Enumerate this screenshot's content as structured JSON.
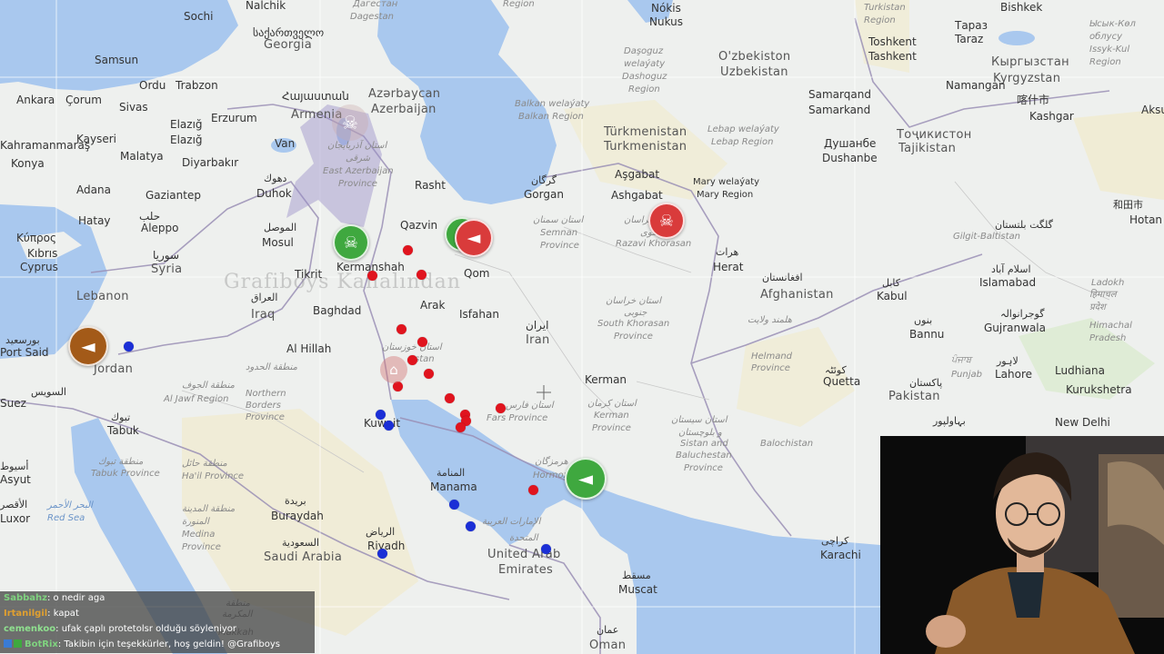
{
  "map": {
    "colors": {
      "water": "#a9c8ee",
      "land": "#eef0ee",
      "desert": "#f2e9c4",
      "green": "#d6e9c6",
      "border": "#9a8fb5",
      "protest_green": "#3fa83f",
      "protest_red": "#d93b3b",
      "protest_brown": "#a35a18",
      "dot_red": "#e0141e",
      "dot_blue": "#1b2fd6"
    },
    "watermark": "Grafiboys Kanalından",
    "cities": [
      {
        "id": "nalchik",
        "text": "Nalchik"
      },
      {
        "id": "sochi",
        "text": "Sochi"
      },
      {
        "id": "georgia-geo",
        "text": "საქართველო"
      },
      {
        "id": "georgia",
        "text": "Georgia"
      },
      {
        "id": "samsun",
        "text": "Samsun"
      },
      {
        "id": "ordu",
        "text": "Ordu"
      },
      {
        "id": "trabzon",
        "text": "Trabzon"
      },
      {
        "id": "ankara",
        "text": "Ankara"
      },
      {
        "id": "corum",
        "text": "Çorum"
      },
      {
        "id": "sivas",
        "text": "Sivas"
      },
      {
        "id": "elazig1",
        "text": "Elazığ"
      },
      {
        "id": "elazig2",
        "text": "Elazığ"
      },
      {
        "id": "erzurum",
        "text": "Erzurum"
      },
      {
        "id": "kayseri",
        "text": "Kayseri"
      },
      {
        "id": "kahramanmaras",
        "text": "Kahramanmaraş"
      },
      {
        "id": "konya",
        "text": "Konya"
      },
      {
        "id": "malatya",
        "text": "Malatya"
      },
      {
        "id": "diyarbakir",
        "text": "Diyarbakır"
      },
      {
        "id": "adana",
        "text": "Adana"
      },
      {
        "id": "gaziantep",
        "text": "Gaziantep"
      },
      {
        "id": "hatay",
        "text": "Hatay"
      },
      {
        "id": "aleppo-ar",
        "text": "حلب"
      },
      {
        "id": "aleppo",
        "text": "Aleppo"
      },
      {
        "id": "kibris",
        "text": "Κύπρος"
      },
      {
        "id": "kibris2",
        "text": "Kıbrıs"
      },
      {
        "id": "cyprus",
        "text": "Cyprus"
      },
      {
        "id": "syria-ar",
        "text": "سوريا"
      },
      {
        "id": "syria",
        "text": "Syria"
      },
      {
        "id": "lebanon",
        "text": "Lebanon"
      },
      {
        "id": "portsaid-ar",
        "text": "بورسعيد"
      },
      {
        "id": "portsaid",
        "text": "Port Said"
      },
      {
        "id": "jordan",
        "text": "Jordan"
      },
      {
        "id": "suez-ar",
        "text": "السويس"
      },
      {
        "id": "suez",
        "text": "Suez"
      },
      {
        "id": "tabuk-ar",
        "text": "تبوك"
      },
      {
        "id": "tabuk",
        "text": "Tabuk"
      },
      {
        "id": "asyut-ar",
        "text": "أسيوط"
      },
      {
        "id": "asyut",
        "text": "Asyut"
      },
      {
        "id": "luxor-ar",
        "text": "الأقصر"
      },
      {
        "id": "luxor",
        "text": "Luxor"
      },
      {
        "id": "armenia-ar",
        "text": "Հայաստան"
      },
      {
        "id": "armenia",
        "text": "Armenia"
      },
      {
        "id": "azerbaycan",
        "text": "Azərbaycan"
      },
      {
        "id": "azerbaijan",
        "text": "Azerbaijan"
      },
      {
        "id": "van",
        "text": "Van"
      },
      {
        "id": "duhok-ar",
        "text": "دهوك"
      },
      {
        "id": "duhok",
        "text": "Duhok"
      },
      {
        "id": "mosul-ar",
        "text": "الموصل"
      },
      {
        "id": "mosul",
        "text": "Mosul"
      },
      {
        "id": "tikrit",
        "text": "Tikrit"
      },
      {
        "id": "iraq-ar",
        "text": "العراق"
      },
      {
        "id": "iraq",
        "text": "Iraq"
      },
      {
        "id": "baghdad",
        "text": "Baghdad"
      },
      {
        "id": "alhillah",
        "text": "Al Hillah"
      },
      {
        "id": "kermanshah",
        "text": "Kermanshah"
      },
      {
        "id": "qazvin",
        "text": "Qazvin"
      },
      {
        "id": "rasht",
        "text": "Rasht"
      },
      {
        "id": "qom",
        "text": "Qom"
      },
      {
        "id": "arak",
        "text": "Arak"
      },
      {
        "id": "isfahan",
        "text": "Isfahan"
      },
      {
        "id": "iran-ar",
        "text": "ایران"
      },
      {
        "id": "iran",
        "text": "Iran"
      },
      {
        "id": "gorgan-ar",
        "text": "گرگان"
      },
      {
        "id": "gorgan",
        "text": "Gorgan"
      },
      {
        "id": "kerman",
        "text": "Kerman"
      },
      {
        "id": "kuwait",
        "text": "Kuwait"
      },
      {
        "id": "manama-ar",
        "text": "المنامة"
      },
      {
        "id": "manama",
        "text": "Manama"
      },
      {
        "id": "buraydah-ar",
        "text": "بريدة"
      },
      {
        "id": "buraydah",
        "text": "Buraydah"
      },
      {
        "id": "riyadh-ar",
        "text": "الرياض"
      },
      {
        "id": "riyadh",
        "text": "Riyadh"
      },
      {
        "id": "saudi-ar",
        "text": "السعودية"
      },
      {
        "id": "saudi",
        "text": "Saudi Arabia"
      },
      {
        "id": "uae",
        "text": "United Arab"
      },
      {
        "id": "emirates",
        "text": "Emirates"
      },
      {
        "id": "muscat-ar",
        "text": "مسقط"
      },
      {
        "id": "muscat",
        "text": "Muscat"
      },
      {
        "id": "oman-ar",
        "text": "عمان"
      },
      {
        "id": "oman",
        "text": "Oman"
      },
      {
        "id": "ashgabat1",
        "text": "Aşgabat"
      },
      {
        "id": "ashgabat2",
        "text": "Ashgabat"
      },
      {
        "id": "turkmenistan1",
        "text": "Türkmenistan"
      },
      {
        "id": "turkmenistan2",
        "text": "Turkmenistan"
      },
      {
        "id": "nukus1",
        "text": "Nókis"
      },
      {
        "id": "nukus2",
        "text": "Nukus"
      },
      {
        "id": "uzbekistan1",
        "text": "O'zbekiston"
      },
      {
        "id": "uzbekistan2",
        "text": "Uzbekistan"
      },
      {
        "id": "samarkand1",
        "text": "Samarqand"
      },
      {
        "id": "samarkand2",
        "text": "Samarkand"
      },
      {
        "id": "dushanbe1",
        "text": "Душанбе"
      },
      {
        "id": "dushanbe2",
        "text": "Dushanbe"
      },
      {
        "id": "tajikistan1",
        "text": "Тоҷикистон"
      },
      {
        "id": "tajikistan2",
        "text": "Tajikistan"
      },
      {
        "id": "tashkent1",
        "text": "Toshkent"
      },
      {
        "id": "tashkent2",
        "text": "Tashkent"
      },
      {
        "id": "namangan",
        "text": "Namangan"
      },
      {
        "id": "kyrgyzstan1",
        "text": "Кыргызстан"
      },
      {
        "id": "kyrgyzstan2",
        "text": "Kyrgyzstan"
      },
      {
        "id": "bishkek",
        "text": "Bishkek"
      },
      {
        "id": "taraz1",
        "text": "Тараз"
      },
      {
        "id": "taraz2",
        "text": "Taraz"
      },
      {
        "id": "kashgar1",
        "text": "喀什市"
      },
      {
        "id": "kashgar2",
        "text": "Kashgar"
      },
      {
        "id": "hotan1",
        "text": "和田市"
      },
      {
        "id": "hotan2",
        "text": "Hotan"
      },
      {
        "id": "herat-ar",
        "text": "هرات"
      },
      {
        "id": "herat",
        "text": "Herat"
      },
      {
        "id": "afghanistan-ar",
        "text": "افغانستان"
      },
      {
        "id": "afghanistan",
        "text": "Afghanistan"
      },
      {
        "id": "kabul-ar",
        "text": "کابل"
      },
      {
        "id": "kabul",
        "text": "Kabul"
      },
      {
        "id": "islamabad-ar",
        "text": "اسلام آباد"
      },
      {
        "id": "islamabad",
        "text": "Islamabad"
      },
      {
        "id": "gujranwala-ar",
        "text": "گوجرانوالہ"
      },
      {
        "id": "gujranwala",
        "text": "Gujranwala"
      },
      {
        "id": "bannu-ar",
        "text": "بنوں"
      },
      {
        "id": "bannu",
        "text": "Bannu"
      },
      {
        "id": "lahore-ar",
        "text": "لاہور"
      },
      {
        "id": "lahore",
        "text": "Lahore"
      },
      {
        "id": "ludhiana",
        "text": "Ludhiana"
      },
      {
        "id": "kurukshetra",
        "text": "Kurukshetra"
      },
      {
        "id": "quetta-ar",
        "text": "کوئٹہ"
      },
      {
        "id": "quetta",
        "text": "Quetta"
      },
      {
        "id": "pakistan-ar",
        "text": "پاکستان"
      },
      {
        "id": "pakistan",
        "text": "Pakistan"
      },
      {
        "id": "newdelhi",
        "text": "New Delhi"
      },
      {
        "id": "bahawalpur-ar",
        "text": "بہاولپور"
      },
      {
        "id": "karachi-ar",
        "text": "کراچی"
      },
      {
        "id": "karachi",
        "text": "Karachi"
      },
      {
        "id": "aksu",
        "text": "Aksu"
      },
      {
        "id": "gilgit-ar",
        "text": "گلگت بلتستان"
      },
      {
        "id": "mary",
        "text": "Mary welaýaty"
      },
      {
        "id": "mary2",
        "text": "Mary Region"
      }
    ],
    "provinces": [
      {
        "id": "dagestan",
        "text": "Dagestan"
      },
      {
        "id": "dagestan2",
        "text": "Дагестан"
      },
      {
        "id": "region-top",
        "text": "Region"
      },
      {
        "id": "daoguz1",
        "text": "Daşoguz"
      },
      {
        "id": "daoguz2",
        "text": "welaýaty"
      },
      {
        "id": "daoguz3",
        "text": "Dashoguz"
      },
      {
        "id": "daoguz4",
        "text": "Region"
      },
      {
        "id": "balkan1",
        "text": "Balkan welaýaty"
      },
      {
        "id": "balkan2",
        "text": "Balkan Region"
      },
      {
        "id": "lebap1",
        "text": "Lebap welaýaty"
      },
      {
        "id": "lebap2",
        "text": "Lebap Region"
      },
      {
        "id": "turkistan1",
        "text": "Turkistan"
      },
      {
        "id": "turkistan2",
        "text": "Region"
      },
      {
        "id": "issyk1",
        "text": "Ысык-Көл"
      },
      {
        "id": "issyk2",
        "text": "облусу"
      },
      {
        "id": "issyk3",
        "text": "Issyk-Kul"
      },
      {
        "id": "issyk4",
        "text": "Region"
      },
      {
        "id": "eastazer1",
        "text": "استان آذربایجان"
      },
      {
        "id": "eastazer2",
        "text": "شرقی"
      },
      {
        "id": "eastazer3",
        "text": "East Azerbaijan"
      },
      {
        "id": "eastazer4",
        "text": "Province"
      },
      {
        "id": "semnan1",
        "text": "استان سمنان"
      },
      {
        "id": "semnan2",
        "text": "Semnan"
      },
      {
        "id": "semnan3",
        "text": "Province"
      },
      {
        "id": "razavi1",
        "text": "استان خراسان"
      },
      {
        "id": "razavi2",
        "text": "رضوی"
      },
      {
        "id": "razavi3",
        "text": "Razavi Khorasan"
      },
      {
        "id": "skhorasan1",
        "text": "استان خراسان"
      },
      {
        "id": "skhorasan2",
        "text": "جنوبی"
      },
      {
        "id": "skhorasan3",
        "text": "South Khorasan"
      },
      {
        "id": "skhorasan4",
        "text": "Province"
      },
      {
        "id": "helmand1",
        "text": "هلمند ولايت"
      },
      {
        "id": "helmand2",
        "text": "Helmand"
      },
      {
        "id": "helmand3",
        "text": "Province"
      },
      {
        "id": "kerman1",
        "text": "استان کرمان"
      },
      {
        "id": "kerman2",
        "text": "Kerman"
      },
      {
        "id": "kerman3",
        "text": "Province"
      },
      {
        "id": "sistan1",
        "text": "استان سیستان"
      },
      {
        "id": "sistan2",
        "text": "و بلوچستان"
      },
      {
        "id": "sistan3",
        "text": "Sistan and"
      },
      {
        "id": "sistan4",
        "text": "Baluchestan"
      },
      {
        "id": "sistan5",
        "text": "Province"
      },
      {
        "id": "balochistan",
        "text": "Balochistan"
      },
      {
        "id": "fars1",
        "text": "استان فارس"
      },
      {
        "id": "fars2",
        "text": "Fars Province"
      },
      {
        "id": "hormoz1",
        "text": "هرمزگان"
      },
      {
        "id": "hormoz2",
        "text": "Hormoz"
      },
      {
        "id": "khuz1",
        "text": "استان خوزستان"
      },
      {
        "id": "khuz2",
        "text": "stan"
      },
      {
        "id": "northern1",
        "text": "منطقة الحدود"
      },
      {
        "id": "northern2",
        "text": "Northern"
      },
      {
        "id": "northern3",
        "text": "Borders"
      },
      {
        "id": "northern4",
        "text": "Province"
      },
      {
        "id": "jawf1",
        "text": "منطقة الجوف"
      },
      {
        "id": "jawf2",
        "text": "Al Jawf Region"
      },
      {
        "id": "hail1",
        "text": "منطقة حائل"
      },
      {
        "id": "hail2",
        "text": "Ha'il Province"
      },
      {
        "id": "tabukp1",
        "text": "منطقة تبوك"
      },
      {
        "id": "tabukp2",
        "text": "Tabuk Province"
      },
      {
        "id": "medina1",
        "text": "منطقة المدينة"
      },
      {
        "id": "medina2",
        "text": "المنورة"
      },
      {
        "id": "medina3",
        "text": "Medina"
      },
      {
        "id": "medina4",
        "text": "Province"
      },
      {
        "id": "makkah1",
        "text": "منطقة"
      },
      {
        "id": "makkah2",
        "text": "المكرمة"
      },
      {
        "id": "makkah3",
        "text": "Makkah"
      },
      {
        "id": "uae-ar1",
        "text": "الإمارات العربية"
      },
      {
        "id": "uae-ar2",
        "text": "المتحدة"
      },
      {
        "id": "gilgit",
        "text": "Gilgit-Baltistan"
      },
      {
        "id": "ladokh",
        "text": "Ladokh"
      },
      {
        "id": "punjab1",
        "text": "ਪੰਜਾਬ"
      },
      {
        "id": "punjab2",
        "text": "Punjab"
      },
      {
        "id": "himachal1",
        "text": "हिमाचल"
      },
      {
        "id": "himachal2",
        "text": "प्रदेश"
      },
      {
        "id": "himachal3",
        "text": "Himachal"
      },
      {
        "id": "himachal4",
        "text": "Pradesh"
      }
    ],
    "water": [
      {
        "id": "redsea-ar",
        "text": "البحر الأحمر"
      },
      {
        "id": "redsea",
        "text": "Red Sea"
      }
    ],
    "markers": [
      {
        "id": "m-kermanshah",
        "kind": "skull",
        "color": "green"
      },
      {
        "id": "m-tehran-green",
        "kind": "skull",
        "color": "green"
      },
      {
        "id": "m-tehran-red",
        "kind": "megaphone",
        "color": "red"
      },
      {
        "id": "m-mashhad",
        "kind": "skull",
        "color": "red"
      },
      {
        "id": "m-bandar",
        "kind": "megaphone",
        "color": "green"
      },
      {
        "id": "m-jordan",
        "kind": "megaphone",
        "color": "brown"
      },
      {
        "id": "m-ahvaz",
        "kind": "building",
        "color": "faded-red"
      },
      {
        "id": "m-tabriz",
        "kind": "skull",
        "color": "faded"
      }
    ],
    "dots": [
      {
        "c": "red"
      },
      {
        "c": "red"
      },
      {
        "c": "red"
      },
      {
        "c": "red"
      },
      {
        "c": "red"
      },
      {
        "c": "red"
      },
      {
        "c": "red"
      },
      {
        "c": "red"
      },
      {
        "c": "red"
      },
      {
        "c": "red"
      },
      {
        "c": "red"
      },
      {
        "c": "red"
      },
      {
        "c": "red"
      },
      {
        "c": "red"
      },
      {
        "c": "red"
      },
      {
        "c": "blue"
      },
      {
        "c": "blue"
      },
      {
        "c": "blue"
      },
      {
        "c": "blue"
      },
      {
        "c": "blue"
      },
      {
        "c": "blue"
      },
      {
        "c": "blue"
      }
    ]
  },
  "chat": [
    {
      "user": "Sabbahz",
      "user_color": "#7fd27f",
      "message": ": o nedir aga"
    },
    {
      "user": "Irtanilgil",
      "user_color": "#e0a030",
      "message": ": kapat"
    },
    {
      "user": "cemenkoo",
      "user_color": "#8fe08f",
      "message": ": ufak çaplı protetolsr olduğu söyleniyor"
    },
    {
      "user": "BotRix",
      "user_color": "#7fd27f",
      "message": ": Takibin için teşekkürler, hoş geldin! @Grafiboys"
    }
  ]
}
